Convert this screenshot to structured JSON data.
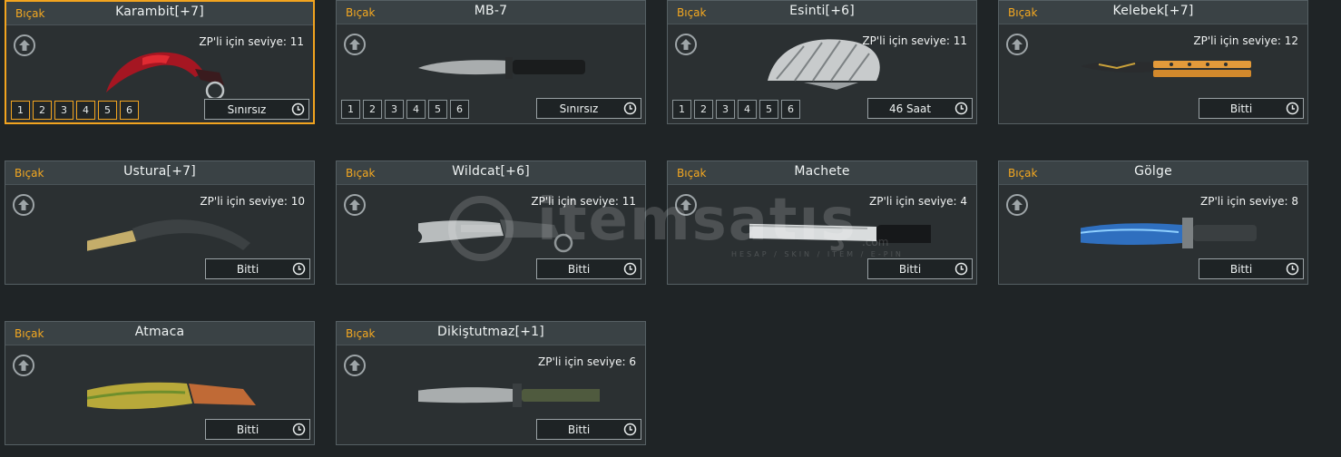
{
  "items": [
    {
      "category": "Bıçak",
      "name": "Karambit[+7]",
      "level": "ZP'li için seviye: 11",
      "levels": [
        "1",
        "2",
        "3",
        "4",
        "5",
        "6"
      ],
      "duration": "Sınırsız",
      "selected": true,
      "knife_icon": "karambit-icon"
    },
    {
      "category": "Bıçak",
      "name": "MB-7",
      "level": "",
      "levels": [
        "1",
        "2",
        "3",
        "4",
        "5",
        "6"
      ],
      "duration": "Sınırsız",
      "knife_icon": "combat-knife-icon"
    },
    {
      "category": "Bıçak",
      "name": "Esinti[+6]",
      "level": "ZP'li için seviye: 11",
      "levels": [
        "1",
        "2",
        "3",
        "4",
        "5",
        "6"
      ],
      "duration": "46 Saat",
      "knife_icon": "fan-blade-icon"
    },
    {
      "category": "Bıçak",
      "name": "Kelebek[+7]",
      "level": "ZP'li için seviye: 12",
      "levels": [],
      "duration": "Bitti",
      "knife_icon": "butterfly-knife-icon"
    },
    {
      "category": "Bıçak",
      "name": "Ustura[+7]",
      "level": "ZP'li için seviye: 10",
      "levels": [],
      "duration": "Bitti",
      "knife_icon": "razor-knife-icon"
    },
    {
      "category": "Bıçak",
      "name": "Wildcat[+6]",
      "level": "ZP'li için seviye: 11",
      "levels": [],
      "duration": "Bitti",
      "knife_icon": "wildcat-knife-icon"
    },
    {
      "category": "Bıçak",
      "name": "Machete",
      "level": "ZP'li için seviye: 4",
      "levels": [],
      "duration": "Bitti",
      "knife_icon": "machete-icon"
    },
    {
      "category": "Bıçak",
      "name": "Gölge",
      "level": "ZP'li için seviye: 8",
      "levels": [],
      "duration": "Bitti",
      "knife_icon": "dagger-icon"
    },
    {
      "category": "Bıçak",
      "name": "Atmaca",
      "level": "",
      "levels": [],
      "duration": "Bitti",
      "knife_icon": "kukri-icon"
    },
    {
      "category": "Bıçak",
      "name": "Dikiştutmaz[+1]",
      "level": "ZP'li için seviye: 6",
      "levels": [],
      "duration": "Bitti",
      "knife_icon": "spear-knife-icon"
    }
  ],
  "watermark": {
    "text": "itemsatış",
    "domain": ".com",
    "subtitle": "HESAP / SKIN / ITEM / E-PIN"
  },
  "colors": {
    "accent": "#f4a820",
    "selected_border": "#f2a41f",
    "card_bg": "#2b3032",
    "header_bg": "#3a4245",
    "page_bg": "#1f2426"
  }
}
